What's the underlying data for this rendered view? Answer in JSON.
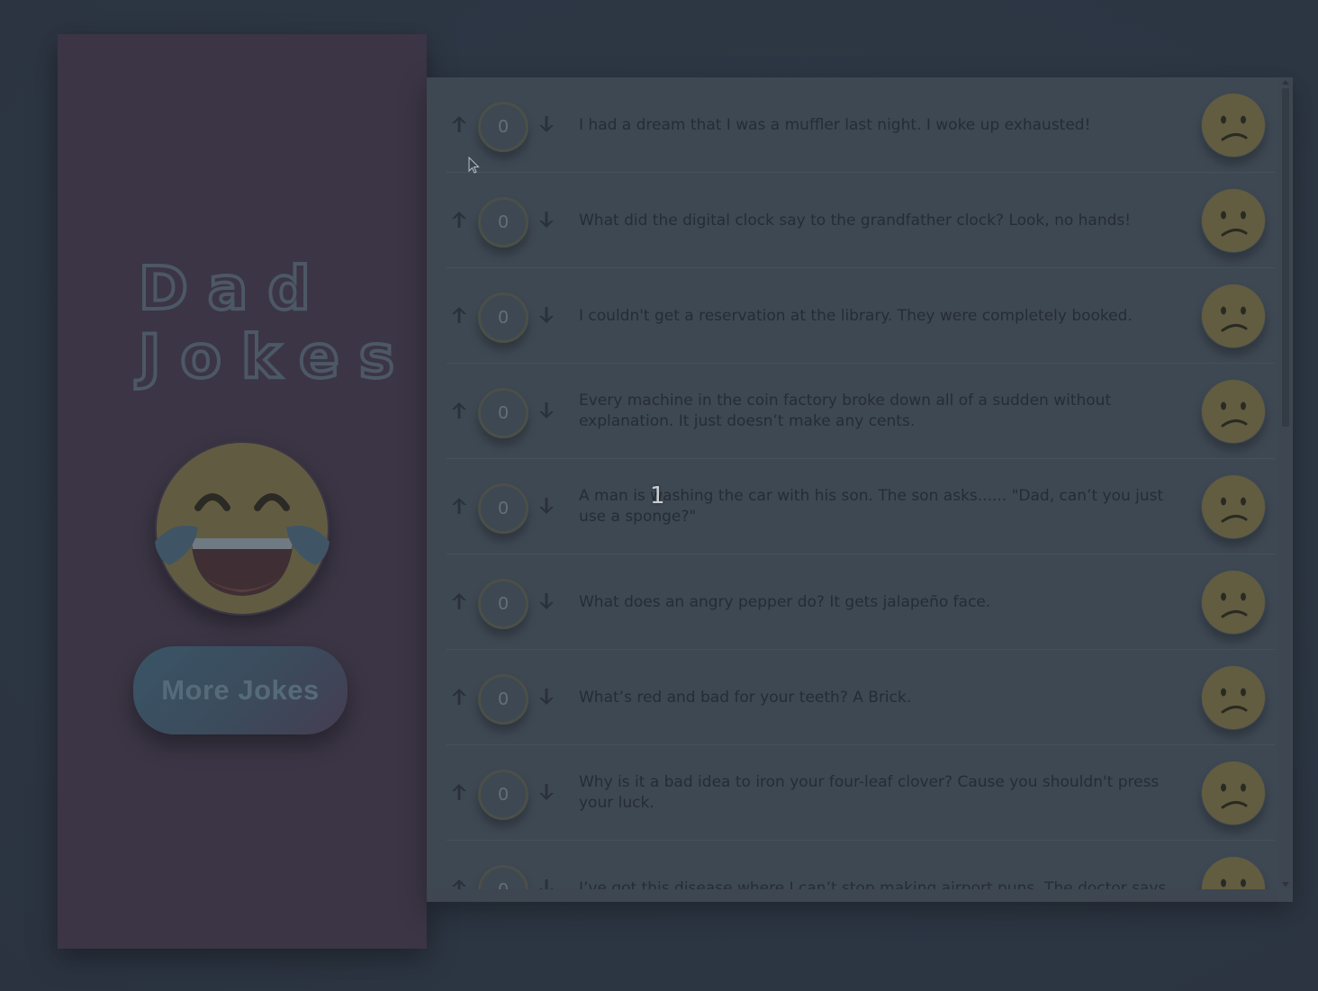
{
  "app": {
    "title_line1": "Dad",
    "title_line2": "Jokes",
    "more_button_label": "More Jokes",
    "laugh_icon": "laughing-tears-emoji-icon"
  },
  "jokes": [
    {
      "votes": "0",
      "text": "I had a dream that I was a muffler last night. I woke up exhausted!",
      "face": "confused-face-icon"
    },
    {
      "votes": "0",
      "text": "What did the digital clock say to the grandfather clock? Look, no hands!",
      "face": "confused-face-icon"
    },
    {
      "votes": "0",
      "text": "I couldn't get a reservation at the library. They were completely booked.",
      "face": "confused-face-icon"
    },
    {
      "votes": "0",
      "text": "Every machine in the coin factory broke down all of a sudden without explanation. It just doesn’t make any cents.",
      "face": "confused-face-icon"
    },
    {
      "votes": "0",
      "text": "A man is washing the car with his son. The son asks...... \"Dad, can’t you just use a sponge?\"",
      "face": "confused-face-icon"
    },
    {
      "votes": "0",
      "text": "What does an angry pepper do? It gets jalapeño face.",
      "face": "confused-face-icon"
    },
    {
      "votes": "0",
      "text": "What’s red and bad for your teeth? A Brick.",
      "face": "confused-face-icon"
    },
    {
      "votes": "0",
      "text": "Why is it a bad idea to iron your four-leaf clover? Cause you shouldn't press your luck.",
      "face": "confused-face-icon"
    },
    {
      "votes": "0",
      "text": "I’ve got this disease where I can’t stop making airport puns. The doctor says",
      "face": "confused-face-icon"
    }
  ],
  "overlay": {
    "cursor_badge": "1"
  },
  "colors": {
    "sidebar_bg": "#3b3545",
    "panel_bg": "#3e4853",
    "emoji_yellow": "#6b6444",
    "button_gradient_start": "#3a5566"
  }
}
